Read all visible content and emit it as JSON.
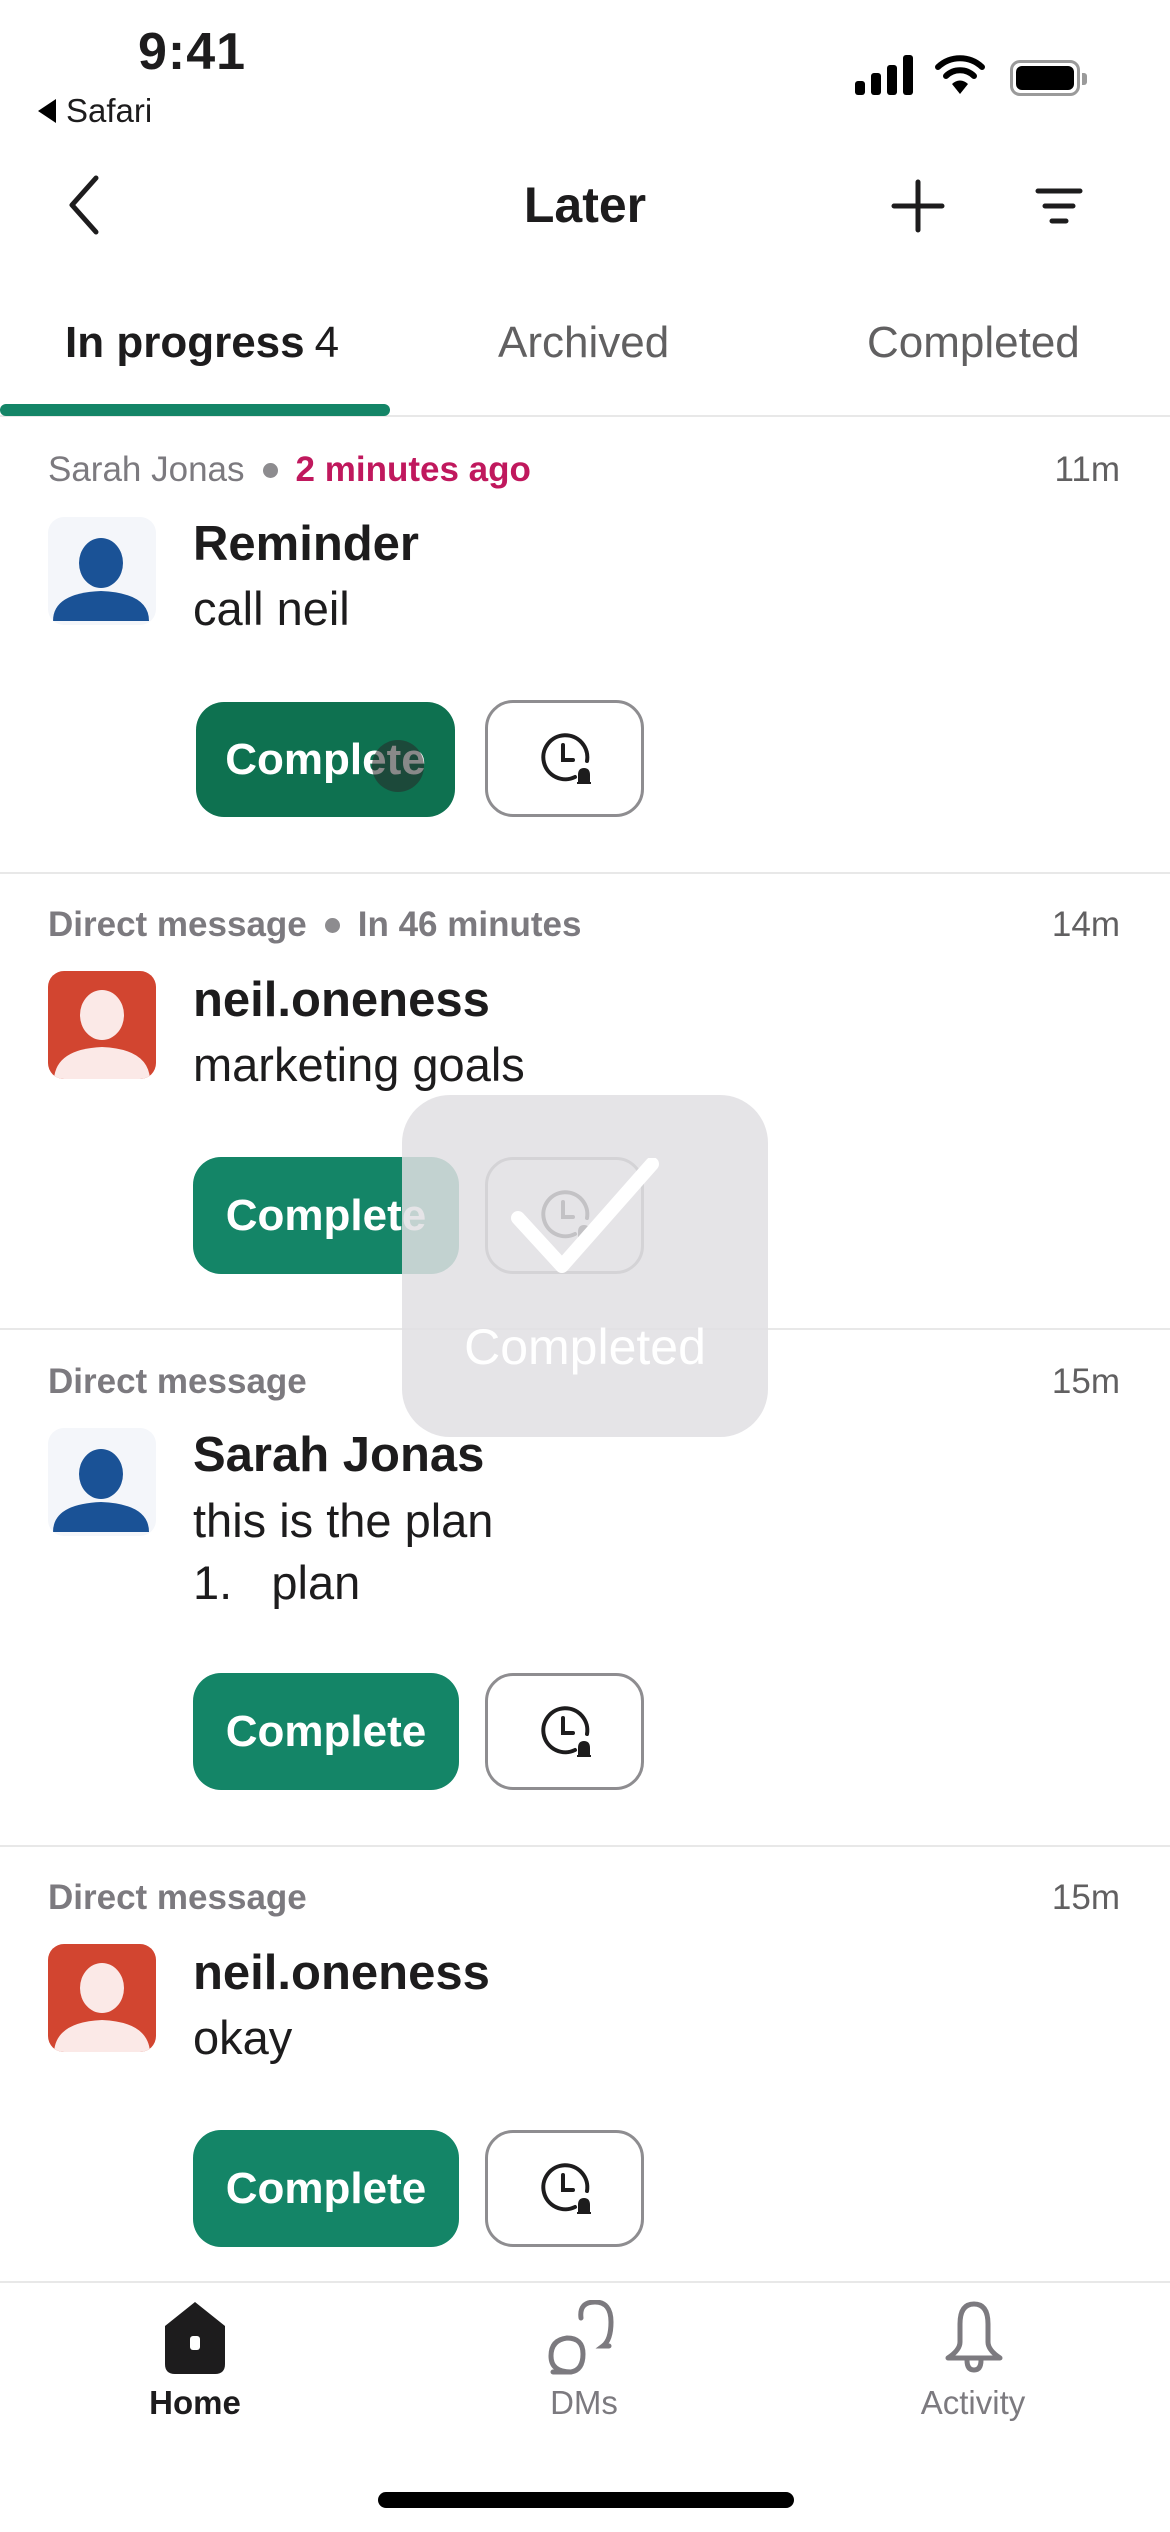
{
  "status_bar": {
    "time": "9:41",
    "back_app": "Safari"
  },
  "nav": {
    "title": "Later",
    "back_icon": "chevron-left-icon",
    "add_icon": "plus-icon",
    "filter_icon": "filter-icon"
  },
  "tabs": [
    {
      "label": "In progress",
      "count": "4",
      "active": true
    },
    {
      "label": "Archived",
      "active": false
    },
    {
      "label": "Completed",
      "active": false
    }
  ],
  "items": [
    {
      "source": "Sarah Jonas",
      "due": "2 minutes ago",
      "due_status": "overdue",
      "age": "11m",
      "avatar": "blue-person",
      "title": "Reminder",
      "body": [
        "call neil"
      ],
      "complete_label": "Complete",
      "snooze_icon": "clock-bell-icon"
    },
    {
      "source": "Direct message",
      "due": "In 46 minutes",
      "due_status": "upcoming",
      "age": "14m",
      "avatar": "red-person",
      "title": "neil.oneness",
      "body": [
        "marketing goals"
      ],
      "complete_label": "Complete",
      "snooze_icon": "clock-bell-icon"
    },
    {
      "source": "Direct message",
      "age": "15m",
      "avatar": "blue-person",
      "title": "Sarah Jonas",
      "body": [
        "this is the plan",
        "1.   plan"
      ],
      "complete_label": "Complete",
      "snooze_icon": "clock-bell-icon"
    },
    {
      "source": "Direct message",
      "age": "15m",
      "avatar": "red-person",
      "title": "neil.oneness",
      "body": [
        "okay"
      ],
      "complete_label": "Complete",
      "snooze_icon": "clock-bell-icon"
    }
  ],
  "hud": {
    "label": "Completed",
    "icon": "checkmark-icon"
  },
  "tabbar": [
    {
      "label": "Home",
      "icon": "home-icon",
      "active": true
    },
    {
      "label": "DMs",
      "icon": "dms-icon",
      "active": false
    },
    {
      "label": "Activity",
      "icon": "bell-icon",
      "active": false
    }
  ],
  "colors": {
    "accent_green": "#148567",
    "overdue_red": "#c0185d",
    "avatar_blue": "#1a5296",
    "avatar_red": "#d24530"
  }
}
